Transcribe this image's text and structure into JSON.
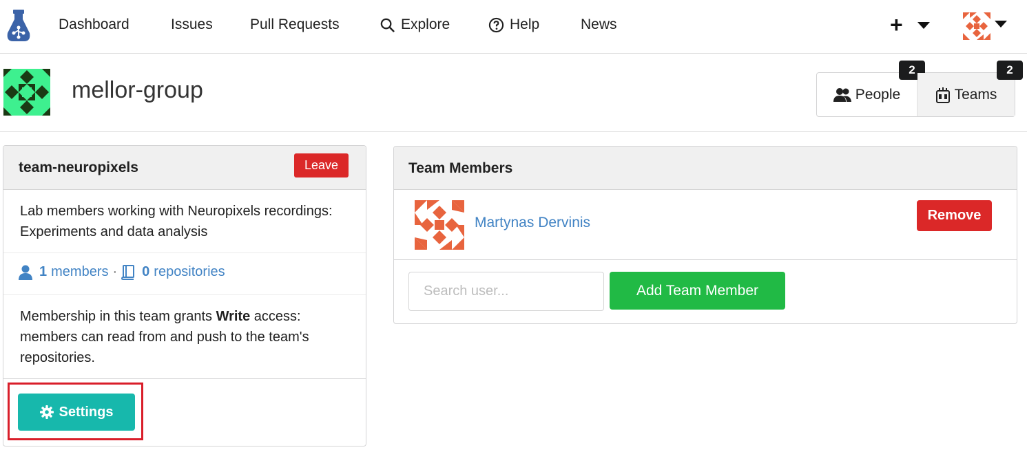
{
  "nav": {
    "dashboard": "Dashboard",
    "issues": "Issues",
    "pull_requests": "Pull Requests",
    "explore": "Explore",
    "help": "Help",
    "news": "News",
    "create_icon": "+"
  },
  "org": {
    "name": "mellor-group",
    "people_label": "People",
    "people_count": "2",
    "teams_label": "Teams",
    "teams_count": "2"
  },
  "team": {
    "name": "team-neuropixels",
    "leave_label": "Leave",
    "description": "Lab members working with Neuropixels recordings: Experiments and data analysis",
    "members_count": "1",
    "members_label": "members",
    "separator": "·",
    "repos_count": "0",
    "repos_label": "repositories",
    "grant_prefix": "Membership in this team grants ",
    "grant_access": "Write",
    "grant_suffix": " access: members can read from and push to the team's repositories.",
    "settings_label": "Settings"
  },
  "members": {
    "title": "Team Members",
    "rows": [
      {
        "name": "Martynas Dervinis",
        "remove_label": "Remove"
      }
    ],
    "search_placeholder": "Search user...",
    "add_label": "Add Team Member"
  },
  "colors": {
    "leave_red": "#db2828",
    "settings_teal": "#17b8ac",
    "add_green": "#21ba45",
    "link_blue": "#4183c4",
    "highlight_red": "#d91e2a"
  },
  "icons": [
    "gitea-logo-icon",
    "search-icon",
    "help-circle-icon",
    "plus-icon",
    "caret-down-icon",
    "people-icon",
    "teams-icon",
    "user-icon",
    "book-icon",
    "gear-icon"
  ]
}
